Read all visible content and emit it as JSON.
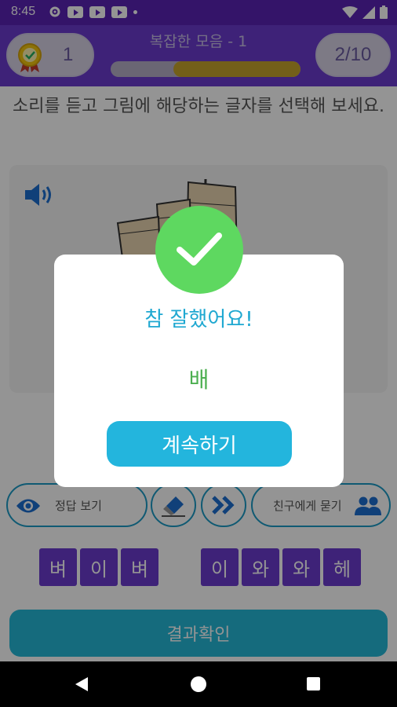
{
  "status_bar": {
    "time": "8:45"
  },
  "header": {
    "title": "복잡한 모음 - 1",
    "score": "1",
    "progress_label": "2/10",
    "progress_fraction": 0.67
  },
  "instruction": "소리를 듣고 그림에 해당하는 글자를 선택해 보세요.",
  "buttons": {
    "show_answer": "정답 보기",
    "ask_friend": "친구에게 묻기",
    "check_result": "결과확인"
  },
  "tiles_left": [
    "벼",
    "이",
    "벼"
  ],
  "tiles_right": [
    "이",
    "와",
    "와",
    "헤"
  ],
  "dialog": {
    "message": "참 잘했어요!",
    "answer": "배",
    "continue_label": "계속하기"
  },
  "colors": {
    "header_purple": "#6c3ccf",
    "accent_blue": "#23b5dd",
    "success_green": "#5ed860",
    "answer_green": "#4caf50"
  }
}
